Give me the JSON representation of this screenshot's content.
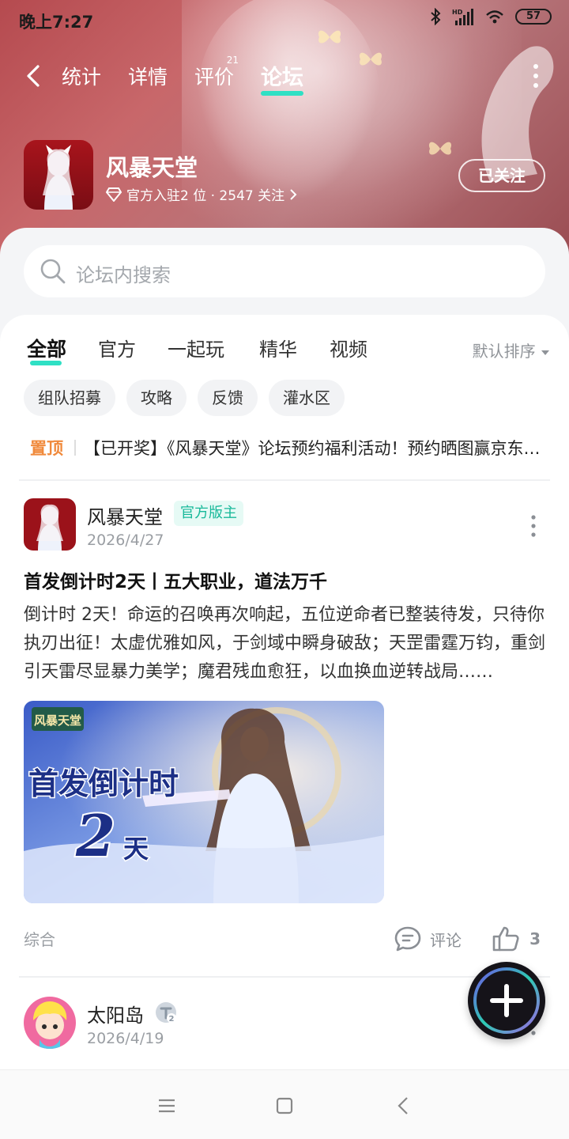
{
  "status_bar": {
    "time": "晚上7:27",
    "battery": "57",
    "icons": [
      "bluetooth-icon",
      "hd-signal-icon",
      "wifi-icon",
      "battery-icon"
    ]
  },
  "top_nav": {
    "tabs": [
      {
        "label": "统计"
      },
      {
        "label": "详情"
      },
      {
        "label": "评价",
        "badge": "21"
      },
      {
        "label": "论坛",
        "active": true
      }
    ]
  },
  "game": {
    "name": "风暴天堂",
    "meta": "官方入驻2 位 · 2547 关注",
    "follow_label": "已关注"
  },
  "search": {
    "placeholder": "论坛内搜索"
  },
  "category_tabs": [
    {
      "label": "全部",
      "active": true
    },
    {
      "label": "官方"
    },
    {
      "label": "一起玩"
    },
    {
      "label": "精华"
    },
    {
      "label": "视频"
    }
  ],
  "sort_label": "默认排序",
  "chips": [
    "组队招募",
    "攻略",
    "反馈",
    "灌水区"
  ],
  "pinned": {
    "tag": "置顶",
    "text": "【已开奖】《风暴天堂》论坛预约福利活动！预约晒图赢京东卡！"
  },
  "posts": [
    {
      "author": "风暴天堂",
      "badge": "官方版主",
      "date": "2026/4/27",
      "title": "首发倒计时2天丨五大职业，道法万千",
      "body": "倒计时 2天！命运的召唤再次响起，五位逆命者已整装待发，只待你执刃出征！太虚优雅如风，于剑域中瞬身破敌；天罡雷霆万钧，重剑引天雷尽显暴力美学；魔君残血愈狂，以血换血逆转战局……",
      "image": {
        "logo": "风暴天堂",
        "headline": "首发倒计时",
        "big_number": "2",
        "unit": "天"
      },
      "category": "综合",
      "comment_label": "评论",
      "likes": "3"
    },
    {
      "author": "太阳岛",
      "level": "2",
      "date": "2026/4/19"
    }
  ],
  "colors": {
    "accent": "#2fe0c4",
    "pinned_tag": "#f08a3c",
    "official_badge_bg": "#e6faf5",
    "official_badge_text": "#18b99a"
  }
}
